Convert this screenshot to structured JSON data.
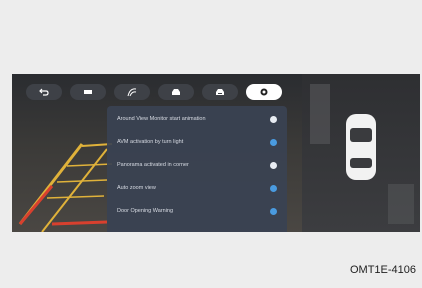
{
  "settings": {
    "items": [
      {
        "label": "Around View Monitor start animation",
        "state": "off"
      },
      {
        "label": "AVM activation by turn light",
        "state": "on"
      },
      {
        "label": "Panorama activated in corner",
        "state": "off"
      },
      {
        "label": "Auto zoom view",
        "state": "on"
      },
      {
        "label": "Door Opening Warning",
        "state": "on"
      }
    ]
  },
  "toolbar": {
    "tabs": [
      {
        "icon": "back-icon"
      },
      {
        "icon": "battery-icon"
      },
      {
        "icon": "trajectory-icon"
      },
      {
        "icon": "car-front-icon"
      },
      {
        "icon": "car-rear-icon"
      },
      {
        "icon": "settings-icon",
        "active": true
      }
    ]
  },
  "figure": {
    "code": "OMT1E-4106"
  },
  "colors": {
    "toggle_on": "#4a9be0",
    "toggle_off": "#e8ecf2",
    "guideline_yellow": "#e0b23a",
    "guideline_red": "#d8402e"
  }
}
